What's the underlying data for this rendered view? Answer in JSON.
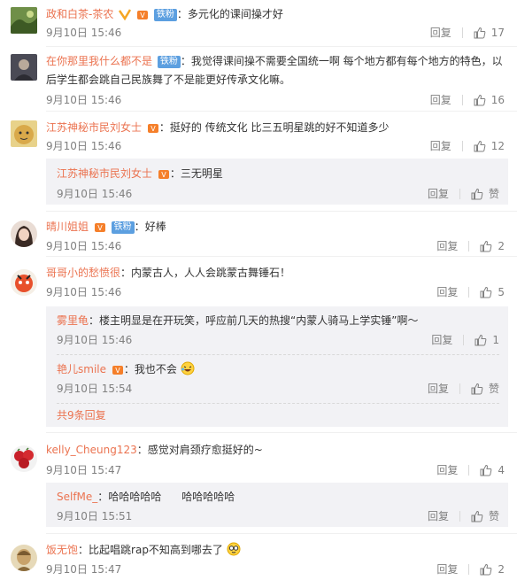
{
  "labels": {
    "reply": "回复",
    "like_default": "赞",
    "colon": "："
  },
  "comments": [
    {
      "user": "政和白茶-茶农",
      "text": "多元化的课间操才好",
      "time": "9月10日 15:46",
      "likes": "17",
      "fan_badge": "铁粉"
    },
    {
      "user": "在你那里我什么都不是",
      "text": "我觉得课间操不需要全国统一啊 每个地方都有每个地方的特色，以后学生都会跳自己民族舞了不是能更好传承文化嘛。",
      "time": "9月10日 15:46",
      "likes": "16",
      "fan_badge": "铁粉"
    },
    {
      "user": "江苏神秘市民刘女士",
      "text": "挺好的 传统文化 比三五明星跳的好不知道多少",
      "time": "9月10日 15:46",
      "likes": "12"
    },
    {
      "user": "晴川姐姐",
      "text": "好棒",
      "time": "9月10日 15:46",
      "likes": "2",
      "fan_badge": "铁粉"
    },
    {
      "user": "哥哥小的愁愤很",
      "text": "内蒙古人，人人会跳蒙古舞锤石！",
      "time": "9月10日 15:46",
      "likes": "5"
    },
    {
      "user": "kelly_Cheung123",
      "text": "感觉对肩颈疗愈挺好的~",
      "time": "9月10日 15:47",
      "likes": "4"
    },
    {
      "user": "饭无饱",
      "text": "比起唱跳rap不知高到哪去了",
      "time": "9月10日 15:47",
      "likes": "2"
    }
  ],
  "replies": {
    "r1": {
      "user": "江苏神秘市民刘女士",
      "text": "三无明星",
      "time": "9月10日 15:46",
      "likes": "赞"
    },
    "r2": {
      "user": "雾里龟",
      "text": "楼主明显是在开玩笑，呼应前几天的热搜“内蒙人骑马上学实锤”啊～",
      "time": "9月10日 15:46",
      "likes": "1"
    },
    "r3": {
      "user": "艳儿smile",
      "text": "我也不会",
      "time": "9月10日 15:54",
      "likes": "赞"
    },
    "r4": {
      "user": "SelfMe_",
      "text": "哈哈哈哈哈      哈哈哈哈哈",
      "time": "9月10日 15:51",
      "likes": "赞"
    }
  },
  "more_replies": "共9条回复",
  "colors": {
    "username": "#eb7350",
    "meta": "#808080",
    "subpanel": "#f2f2f5",
    "fan_badge": "#5c9fe0"
  }
}
